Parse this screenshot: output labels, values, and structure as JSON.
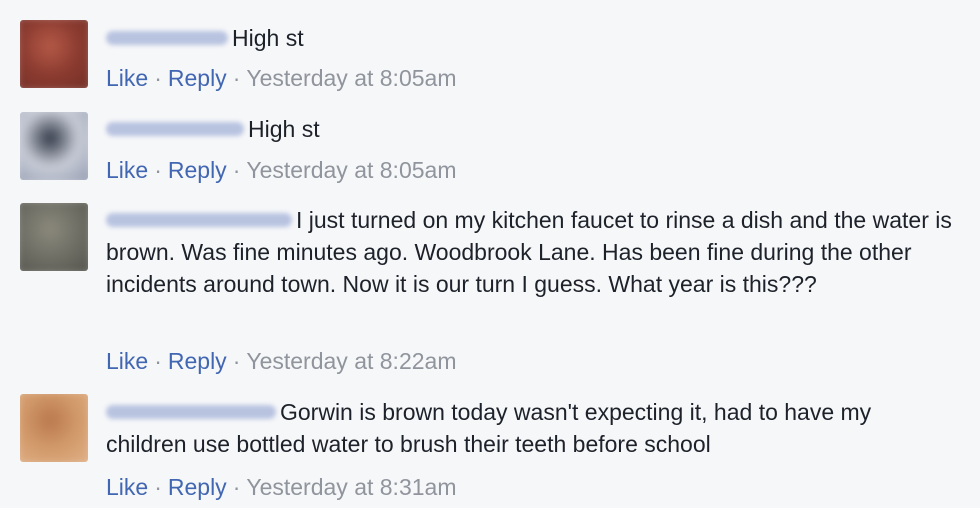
{
  "comments": [
    {
      "text": "High st",
      "like": "Like",
      "reply": "Reply",
      "sep": "·",
      "time": "Yesterday at 8:05am",
      "avatar_colors": [
        "#8c3b30",
        "#b55a48",
        "#6e2d25"
      ]
    },
    {
      "text": "High st",
      "like": "Like",
      "reply": "Reply",
      "sep": "·",
      "time": "Yesterday at 8:05am",
      "avatar_colors": [
        "#c9cdd8",
        "#2f3644",
        "#8a93a8"
      ]
    },
    {
      "text": "I just turned on my kitchen faucet to rinse a dish and the water is brown. Was fine minutes ago. Woodbrook Lane. Has been fine during the other incidents around town. Now it is our turn I guess. What year is this???",
      "like": "Like",
      "reply": "Reply",
      "sep": "·",
      "time": "Yesterday at 8:22am",
      "avatar_colors": [
        "#6f6f66",
        "#8c8a7c",
        "#4f4f48"
      ]
    },
    {
      "text": "Gorwin is brown today wasn't expecting it, had to have my children use bottled water to brush their teeth before school",
      "like": "Like",
      "reply": "Reply",
      "sep": "·",
      "time": "Yesterday at 8:31am",
      "avatar_colors": [
        "#d29a6a",
        "#b9784d",
        "#e2b48c"
      ]
    }
  ]
}
